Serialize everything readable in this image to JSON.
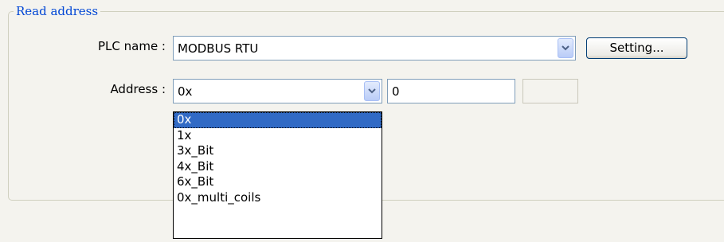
{
  "group": {
    "title": "Read address"
  },
  "plc": {
    "label": "PLC name :",
    "value": "MODBUS RTU",
    "setting_button": "Setting..."
  },
  "address": {
    "label": "Address :",
    "type_value": "0x",
    "number_value": "0",
    "options": [
      "0x",
      "1x",
      "3x_Bit",
      "4x_Bit",
      "6x_Bit",
      "0x_multi_coils"
    ],
    "selected_index": 0
  },
  "icons": {
    "dropdown": "chevron-down-icon"
  },
  "colors": {
    "group_title": "#0046d5",
    "selection": "#316ac5",
    "background": "#f4f3ee"
  }
}
